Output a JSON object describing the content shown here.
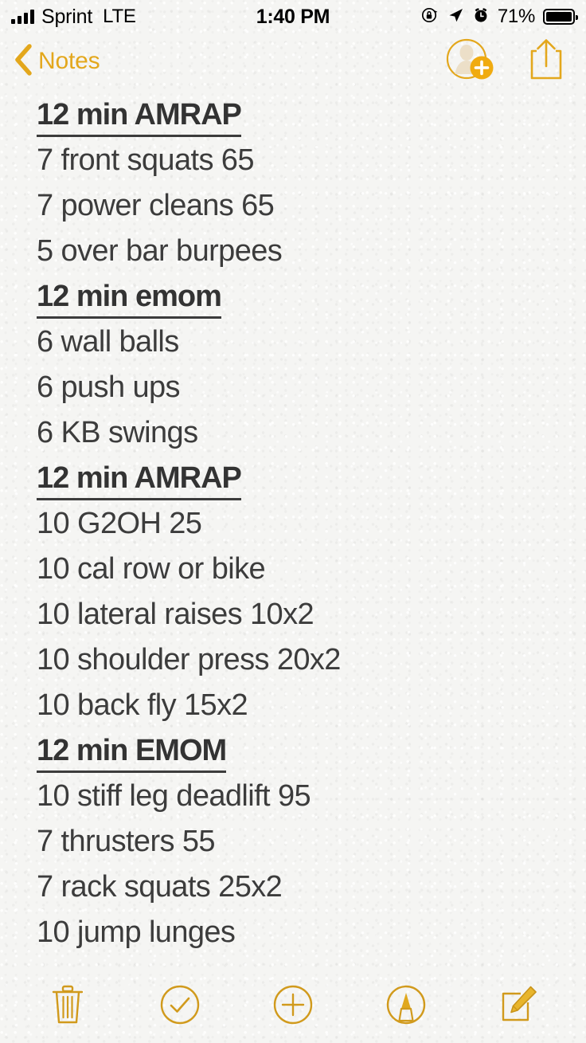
{
  "status_bar": {
    "carrier": "Sprint",
    "network": "LTE",
    "time": "1:40 PM",
    "battery_percent": "71%",
    "icons": [
      "signal-bars-icon",
      "rotation-lock-icon",
      "location-arrow-icon",
      "alarm-clock-icon",
      "battery-icon"
    ]
  },
  "nav_bar": {
    "back_label": "Notes",
    "back_icon": "chevron-left-icon",
    "add_people_icon": "add-person-icon",
    "share_icon": "share-icon"
  },
  "note": {
    "lines": [
      {
        "text": "12 min AMRAP",
        "heading": true
      },
      {
        "text": "7 front squats 65",
        "heading": false
      },
      {
        "text": "7 power cleans 65",
        "heading": false
      },
      {
        "text": "5 over bar burpees",
        "heading": false
      },
      {
        "text": "12 min emom",
        "heading": true
      },
      {
        "text": "6 wall balls",
        "heading": false
      },
      {
        "text": "6 push ups",
        "heading": false
      },
      {
        "text": "6 KB swings",
        "heading": false
      },
      {
        "text": "12 min AMRAP",
        "heading": true
      },
      {
        "text": "10 G2OH 25",
        "heading": false
      },
      {
        "text": "10 cal row or bike",
        "heading": false
      },
      {
        "text": "10 lateral raises 10x2",
        "heading": false
      },
      {
        "text": "10 shoulder press 20x2",
        "heading": false
      },
      {
        "text": "10 back fly 15x2",
        "heading": false
      },
      {
        "text": "12 min EMOM",
        "heading": true
      },
      {
        "text": "10 stiff leg deadlift 95",
        "heading": false
      },
      {
        "text": "7 thrusters 55",
        "heading": false
      },
      {
        "text": "7 rack squats 25x2",
        "heading": false
      },
      {
        "text": "10 jump lunges",
        "heading": false
      }
    ]
  },
  "toolbar": {
    "items": [
      {
        "name": "delete-icon",
        "label": "Delete"
      },
      {
        "name": "checklist-icon",
        "label": "Checklist"
      },
      {
        "name": "add-attachment-icon",
        "label": "Add"
      },
      {
        "name": "markup-icon",
        "label": "Markup"
      },
      {
        "name": "compose-icon",
        "label": "Compose"
      }
    ]
  },
  "colors": {
    "accent": "#e3a71c",
    "accent_dark": "#d19a1c",
    "text": "#3c3c3c",
    "paper": "#f5f5f3"
  }
}
